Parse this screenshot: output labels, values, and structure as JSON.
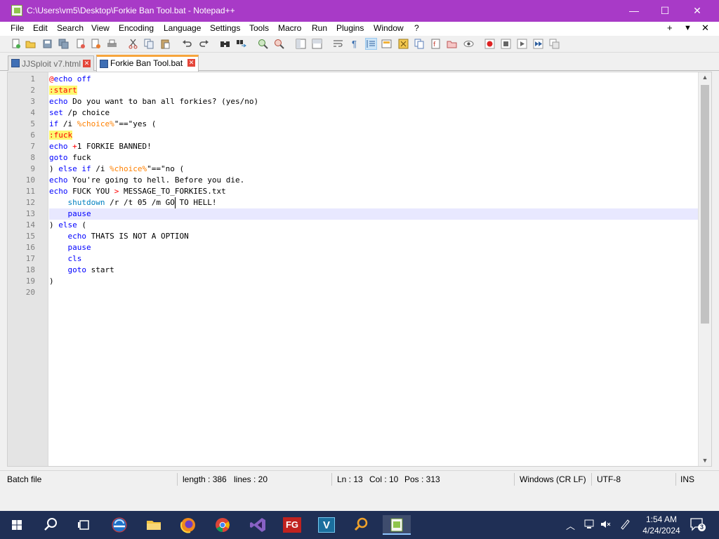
{
  "window": {
    "title": "C:\\Users\\vm5\\Desktop\\Forkie Ban Tool.bat - Notepad++",
    "controls": {
      "minimize": "—",
      "maximize": "☐",
      "close": "✕"
    }
  },
  "menu": {
    "items": [
      "File",
      "Edit",
      "Search",
      "View",
      "Encoding",
      "Language",
      "Settings",
      "Tools",
      "Macro",
      "Run",
      "Plugins",
      "Window",
      "?"
    ],
    "right": {
      "add": "+",
      "dropdown": "▼",
      "close": "✕"
    }
  },
  "toolbar": {
    "icons": [
      "new-file-icon",
      "open-file-icon",
      "save-icon",
      "save-all-icon",
      "close-icon",
      "close-all-icon",
      "print-icon",
      "cut-icon",
      "copy-icon",
      "paste-icon",
      "undo-icon",
      "redo-icon",
      "find-icon",
      "replace-icon",
      "zoom-in-icon",
      "zoom-out-icon",
      "sync-vertical-icon",
      "sync-horizontal-icon",
      "word-wrap-icon",
      "show-all-chars-icon",
      "indent-guide-icon",
      "udl-icon",
      "doc-map-icon",
      "doc-list-icon",
      "function-list-icon",
      "folder-workspace-icon",
      "monitoring-icon",
      "record-macro-icon",
      "stop-macro-icon",
      "play-macro-icon",
      "run-macro-multiple-icon",
      "save-macro-icon"
    ]
  },
  "tabs": [
    {
      "label": "JJSploit v7.html",
      "active": false
    },
    {
      "label": "Forkie Ban Tool.bat",
      "active": true
    }
  ],
  "editor": {
    "current_line": 13,
    "lines": [
      "@echo off",
      ":start",
      "echo Do you want to ban all forkies? (yes/no)",
      "set /p choice=",
      "if /i \"%choice%\"==\"yes\" (",
      ":fuck",
      "echo +1 FORKIE BANNED!",
      "goto fuck",
      ") else if /i \"%choice%\"==\"no\" (",
      "echo You're going to hell. Before you die.",
      "echo FUCK YOU > MESSAGE_TO_FORKIES.txt",
      "    shutdown /r /t 05 /m GO TO HELL!",
      "    pause",
      ") else (",
      "    echo THATS IS NOT A OPTION",
      "    pause",
      "    cls",
      "    goto start",
      ")",
      ""
    ]
  },
  "status": {
    "filetype": "Batch file",
    "length": "length : 386",
    "lines": "lines : 20",
    "ln": "Ln : 13",
    "col": "Col : 10",
    "pos": "Pos : 313",
    "eol": "Windows (CR LF)",
    "encoding": "UTF-8",
    "mode": "INS"
  },
  "taskbar": {
    "apps": [
      "windows-start-icon",
      "search-icon",
      "task-view-icon",
      "edge-icon",
      "file-explorer-icon",
      "firefox-icon",
      "chrome-icon",
      "visual-studio-icon",
      "fg-app-icon",
      "v-app-icon",
      "search-app-icon",
      "notepadpp-icon"
    ],
    "fg_label": "FG",
    "v_label": "V",
    "time": "1:54 AM",
    "date": "4/24/2024",
    "notifications": "3"
  },
  "colors": {
    "titlebar": "#a83ac7",
    "keyword": "#0000ff",
    "variable": "#ff8000",
    "label_highlight": "#fdf871",
    "current_line": "#e8e8ff",
    "active_tab_accent": "#f7a53c"
  }
}
